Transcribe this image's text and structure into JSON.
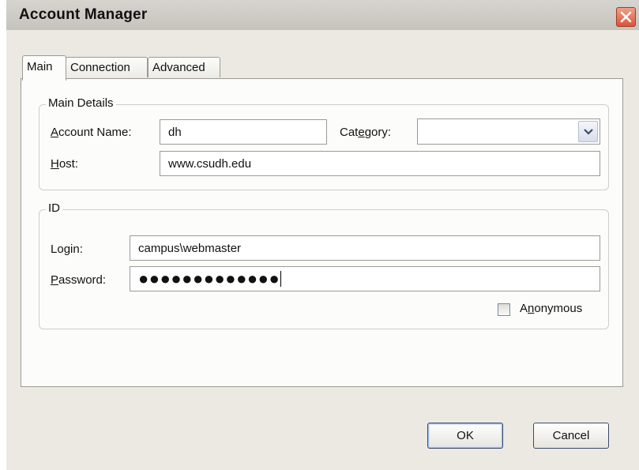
{
  "window": {
    "title": "Account Manager"
  },
  "tabs": [
    {
      "label": "Main",
      "active": true
    },
    {
      "label": "Connection",
      "active": false
    },
    {
      "label": "Advanced",
      "active": false
    }
  ],
  "main_details": {
    "legend": "Main Details",
    "account_name": {
      "label_pre": "",
      "label_key": "A",
      "label_post": "ccount Name:",
      "value": "dh"
    },
    "category": {
      "label_pre": "Cat",
      "label_key": "e",
      "label_post": "gory:",
      "value": ""
    },
    "host": {
      "label_pre": "",
      "label_key": "H",
      "label_post": "ost:",
      "value": "www.csudh.edu"
    }
  },
  "id_group": {
    "legend": "ID",
    "login": {
      "label_pre": "Lo",
      "label_key": "g",
      "label_post": "in:",
      "value": "campus\\webmaster"
    },
    "password": {
      "label_pre": "",
      "label_key": "P",
      "label_post": "assword:",
      "value": "●●●●●●●●●●●●●"
    },
    "anonymous": {
      "label_pre": "A",
      "label_key": "n",
      "label_post": "onymous",
      "checked": false
    }
  },
  "buttons": {
    "ok": "OK",
    "cancel": "Cancel"
  },
  "colors": {
    "close_button": "#d9543a",
    "dialog_bg": "#ece9e3",
    "panel_bg": "#fcfcfb"
  }
}
